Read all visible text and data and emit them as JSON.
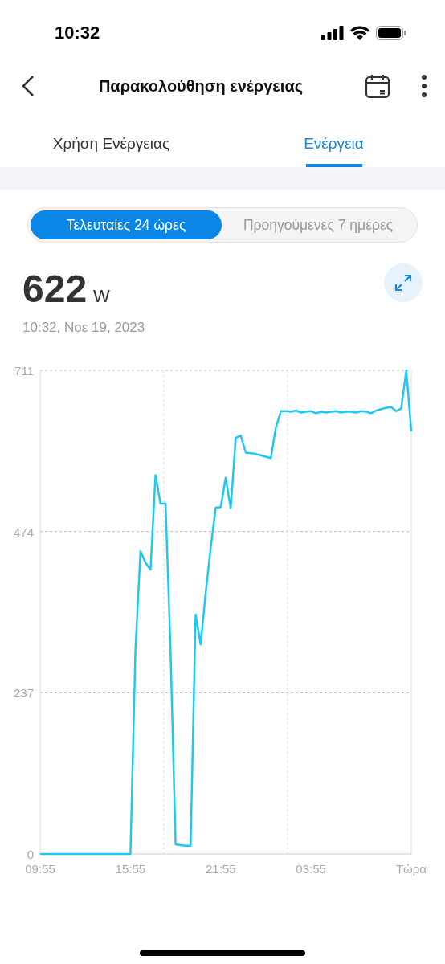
{
  "status_bar": {
    "time": "10:32"
  },
  "header": {
    "title": "Παρακολούθηση ενέργειας"
  },
  "tabs": [
    {
      "label": "Χρήση Ενέργειας",
      "selected": false
    },
    {
      "label": "Ενέργεια",
      "selected": true
    }
  ],
  "range_options": [
    {
      "label": "Τελευταίες 24 ώρες",
      "selected": true
    },
    {
      "label": "Προηγούμενες 7 ημέρες",
      "selected": false
    }
  ],
  "reading": {
    "value": "622",
    "unit": "W",
    "timestamp": "10:32, Νοε 19, 2023"
  },
  "chart_data": {
    "type": "line",
    "ylim": [
      0,
      711
    ],
    "yticks": [
      0,
      237,
      474,
      711
    ],
    "categories": [
      "09:55",
      null,
      null,
      null,
      null,
      null,
      null,
      null,
      null,
      null,
      null,
      null,
      null,
      null,
      null,
      null,
      null,
      null,
      "15:55",
      null,
      null,
      null,
      null,
      null,
      null,
      null,
      null,
      null,
      null,
      null,
      null,
      null,
      null,
      null,
      null,
      null,
      "21:55",
      null,
      null,
      null,
      null,
      null,
      null,
      null,
      null,
      null,
      null,
      null,
      null,
      null,
      null,
      null,
      null,
      null,
      "03:55",
      null,
      null,
      null,
      null,
      null,
      null,
      null,
      null,
      null,
      null,
      null,
      null,
      null,
      null,
      null,
      null,
      null,
      null,
      null,
      "Τώρα"
    ],
    "series": [
      {
        "color": "#1ec8f5",
        "values": [
          0,
          0,
          0,
          0,
          0,
          0,
          0,
          0,
          0,
          0,
          0,
          0,
          0,
          0,
          0,
          0,
          0,
          0,
          0,
          300,
          445,
          428,
          418,
          557,
          515,
          515,
          300,
          14,
          13,
          12,
          12,
          352,
          308,
          383,
          450,
          509,
          510,
          553,
          508,
          612,
          615,
          590,
          589,
          588,
          586,
          584,
          582,
          627,
          651,
          651,
          650,
          652,
          649,
          650,
          651,
          648,
          650,
          649,
          650,
          651,
          649,
          650,
          650,
          649,
          651,
          650,
          648,
          652,
          654,
          656,
          657,
          651,
          655,
          711,
          621
        ]
      }
    ]
  }
}
